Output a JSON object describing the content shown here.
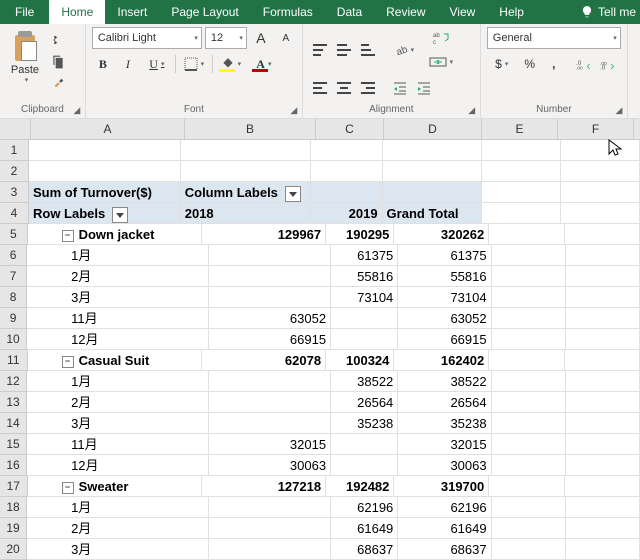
{
  "tabs": {
    "file": "File",
    "home": "Home",
    "insert": "Insert",
    "page_layout": "Page Layout",
    "formulas": "Formulas",
    "data": "Data",
    "review": "Review",
    "view": "View",
    "help": "Help",
    "tell_me": "Tell me"
  },
  "ribbon": {
    "clipboard": {
      "label": "Clipboard",
      "paste": "Paste"
    },
    "font": {
      "label": "Font",
      "name": "Calibri Light",
      "size": "12",
      "B": "B",
      "I": "I",
      "U": "U",
      "incA": "A",
      "decA": "A"
    },
    "alignment": {
      "label": "Alignment"
    },
    "number": {
      "label": "Number",
      "format": "General",
      "pct": "%",
      "comma": ",",
      "inc": ".0",
      "dec": ".00"
    }
  },
  "columns": [
    "A",
    "B",
    "C",
    "D",
    "E",
    "F"
  ],
  "pivot": {
    "measure": "Sum of Turnover($)",
    "col_labels": "Column Labels",
    "row_labels": "Row Labels",
    "y2018": "2018",
    "y2019": "2019",
    "grand_total": "Grand Total",
    "items": [
      {
        "type": "group",
        "name": "Down jacket",
        "v2018": "129967",
        "v2019": "190295",
        "gt": "320262"
      },
      {
        "type": "row",
        "name": "1月",
        "v2018": "",
        "v2019": "61375",
        "gt": "61375"
      },
      {
        "type": "row",
        "name": "2月",
        "v2018": "",
        "v2019": "55816",
        "gt": "55816"
      },
      {
        "type": "row",
        "name": "3月",
        "v2018": "",
        "v2019": "73104",
        "gt": "73104"
      },
      {
        "type": "row",
        "name": "11月",
        "v2018": "63052",
        "v2019": "",
        "gt": "63052"
      },
      {
        "type": "row",
        "name": "12月",
        "v2018": "66915",
        "v2019": "",
        "gt": "66915"
      },
      {
        "type": "group",
        "name": "Casual Suit",
        "v2018": "62078",
        "v2019": "100324",
        "gt": "162402"
      },
      {
        "type": "row",
        "name": "1月",
        "v2018": "",
        "v2019": "38522",
        "gt": "38522"
      },
      {
        "type": "row",
        "name": "2月",
        "v2018": "",
        "v2019": "26564",
        "gt": "26564"
      },
      {
        "type": "row",
        "name": "3月",
        "v2018": "",
        "v2019": "35238",
        "gt": "35238"
      },
      {
        "type": "row",
        "name": "11月",
        "v2018": "32015",
        "v2019": "",
        "gt": "32015"
      },
      {
        "type": "row",
        "name": "12月",
        "v2018": "30063",
        "v2019": "",
        "gt": "30063"
      },
      {
        "type": "group",
        "name": "Sweater",
        "v2018": "127218",
        "v2019": "192482",
        "gt": "319700"
      },
      {
        "type": "row",
        "name": "1月",
        "v2018": "",
        "v2019": "62196",
        "gt": "62196"
      },
      {
        "type": "row",
        "name": "2月",
        "v2018": "",
        "v2019": "61649",
        "gt": "61649"
      },
      {
        "type": "row",
        "name": "3月",
        "v2018": "",
        "v2019": "68637",
        "gt": "68637"
      }
    ]
  },
  "dollar": "$"
}
